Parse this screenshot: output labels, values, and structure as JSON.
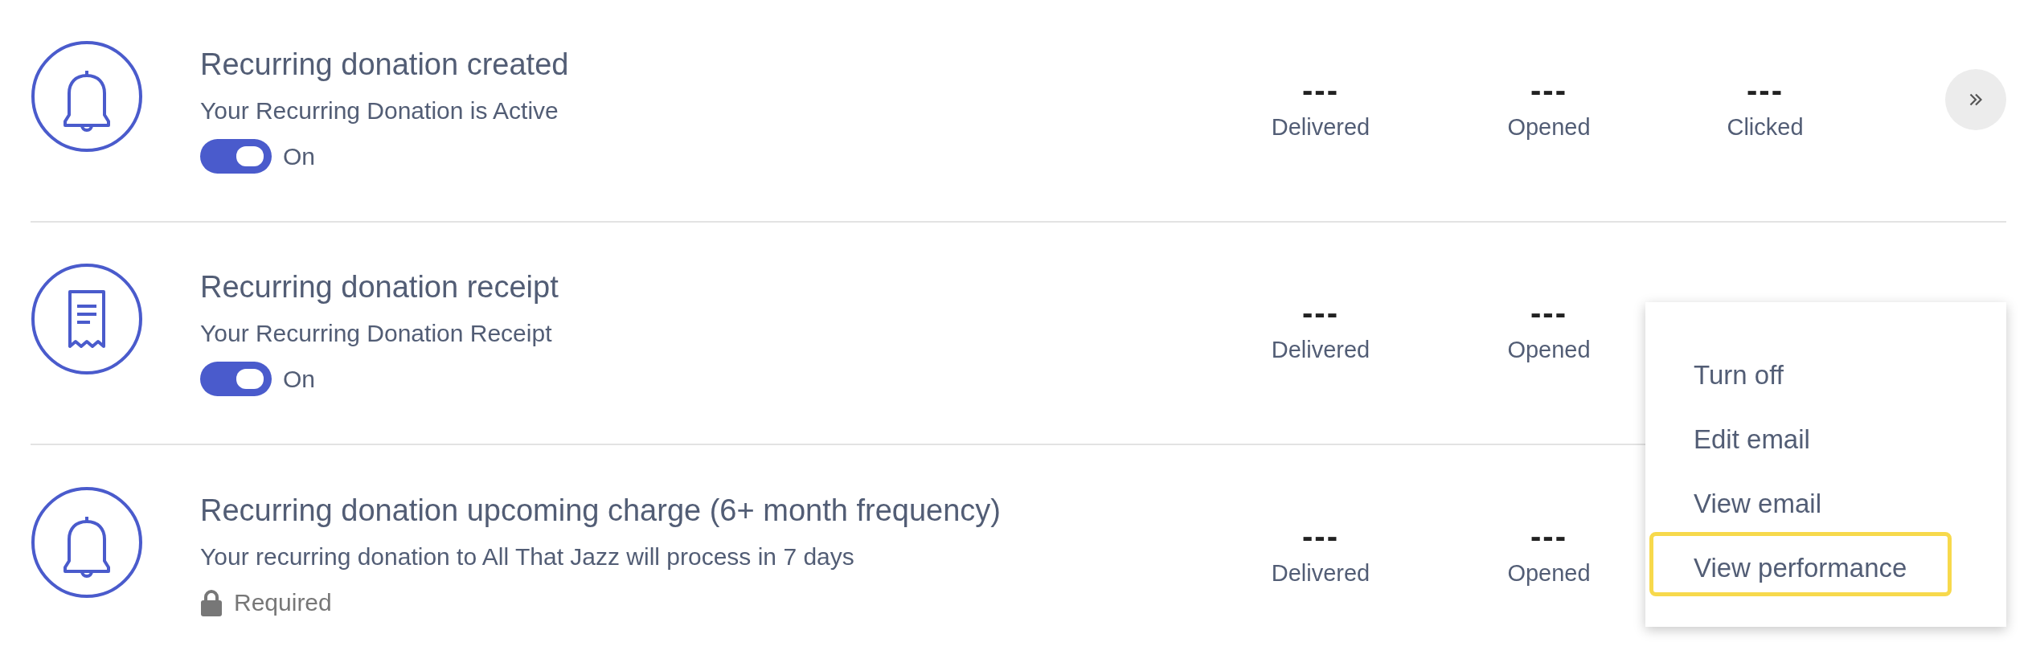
{
  "notifications": [
    {
      "kind": "bell",
      "title": "Recurring donation created",
      "subtitle": "Your Recurring Donation is Active",
      "status": {
        "kind": "toggle",
        "on": true,
        "label": "On"
      },
      "stats": [
        {
          "value": "---",
          "label": "Delivered"
        },
        {
          "value": "---",
          "label": "Opened"
        },
        {
          "value": "---",
          "label": "Clicked"
        }
      ],
      "more_button": true
    },
    {
      "kind": "receipt",
      "title": "Recurring donation receipt",
      "subtitle": "Your Recurring Donation Receipt",
      "status": {
        "kind": "toggle",
        "on": true,
        "label": "On"
      },
      "stats": [
        {
          "value": "---",
          "label": "Delivered"
        },
        {
          "value": "---",
          "label": "Opened"
        }
      ]
    },
    {
      "kind": "bell",
      "title": "Recurring donation upcoming charge (6+ month frequency)",
      "subtitle": "Your recurring donation to All That Jazz will process in 7 days",
      "status": {
        "kind": "locked",
        "label": "Required"
      },
      "stats": [
        {
          "value": "---",
          "label": "Delivered"
        },
        {
          "value": "---",
          "label": "Opened"
        }
      ]
    }
  ],
  "menu": {
    "items": [
      {
        "label": "Turn off",
        "highlighted": false
      },
      {
        "label": "Edit email",
        "highlighted": false
      },
      {
        "label": "View email",
        "highlighted": false
      },
      {
        "label": "View performance",
        "highlighted": true
      }
    ]
  }
}
